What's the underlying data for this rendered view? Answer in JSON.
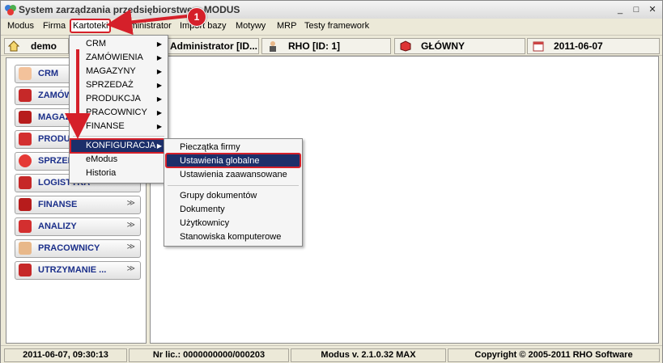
{
  "titlebar": {
    "title": "System zarządzania przedsiębiorstwem MODUS",
    "min": "_",
    "max": "□",
    "close": "✕"
  },
  "menubar": {
    "items": [
      "Modus",
      "Firma",
      "Kartoteki",
      "Administrator",
      "Import bazy",
      "Motywy",
      "MRP",
      "Testy framework"
    ]
  },
  "infobar": {
    "database": "demo",
    "user": "Administrator [ID...",
    "company": "RHO [ID: 1]",
    "warehouse": "GŁÓWNY",
    "date": "2011-06-07"
  },
  "sidebar": {
    "items": [
      {
        "label": "CRM",
        "chev": "≪"
      },
      {
        "label": "ZAMÓWIENIA",
        "chev": "≫"
      },
      {
        "label": "MAGAZYN",
        "chev": "≫"
      },
      {
        "label": "PRODUKCJA",
        "chev": "≫"
      },
      {
        "label": "SPRZEDAŻ",
        "chev": "≫"
      },
      {
        "label": "LOGISTYKA",
        "chev": "≫"
      },
      {
        "label": "FINANSE",
        "chev": "≫"
      },
      {
        "label": "ANALIZY",
        "chev": "≫"
      },
      {
        "label": "PRACOWNICY",
        "chev": "≫"
      },
      {
        "label": "UTRZYMANIE ...",
        "chev": "≫"
      }
    ]
  },
  "kartoteki_menu": {
    "items": [
      "CRM",
      "ZAMÓWIENIA",
      "MAGAZYNY",
      "SPRZEDAŻ",
      "PRODUKCJA",
      "PRACOWNICY",
      "FINANSE",
      "KONFIGURACJA",
      "eModus",
      "Historia"
    ]
  },
  "konfiguracja_menu": {
    "items": [
      "Pieczątka firmy",
      "Ustawienia globalne",
      "Ustawienia zaawansowane",
      "Grupy dokumentów",
      "Dokumenty",
      "Użytkownicy",
      "Stanowiska komputerowe"
    ]
  },
  "annotation": {
    "badge": "1"
  },
  "statusbar": {
    "datetime": "2011-06-07, 09:30:13",
    "license": "Nr lic.: 0000000000/000203",
    "version": "Modus v. 2.1.0.32 MAX",
    "copyright": "Copyright © 2005-2011 RHO Software"
  },
  "colors": {
    "highlight": "#1c2f6a",
    "annotation": "#d5202a",
    "nav_text": "#1b2f8a"
  }
}
